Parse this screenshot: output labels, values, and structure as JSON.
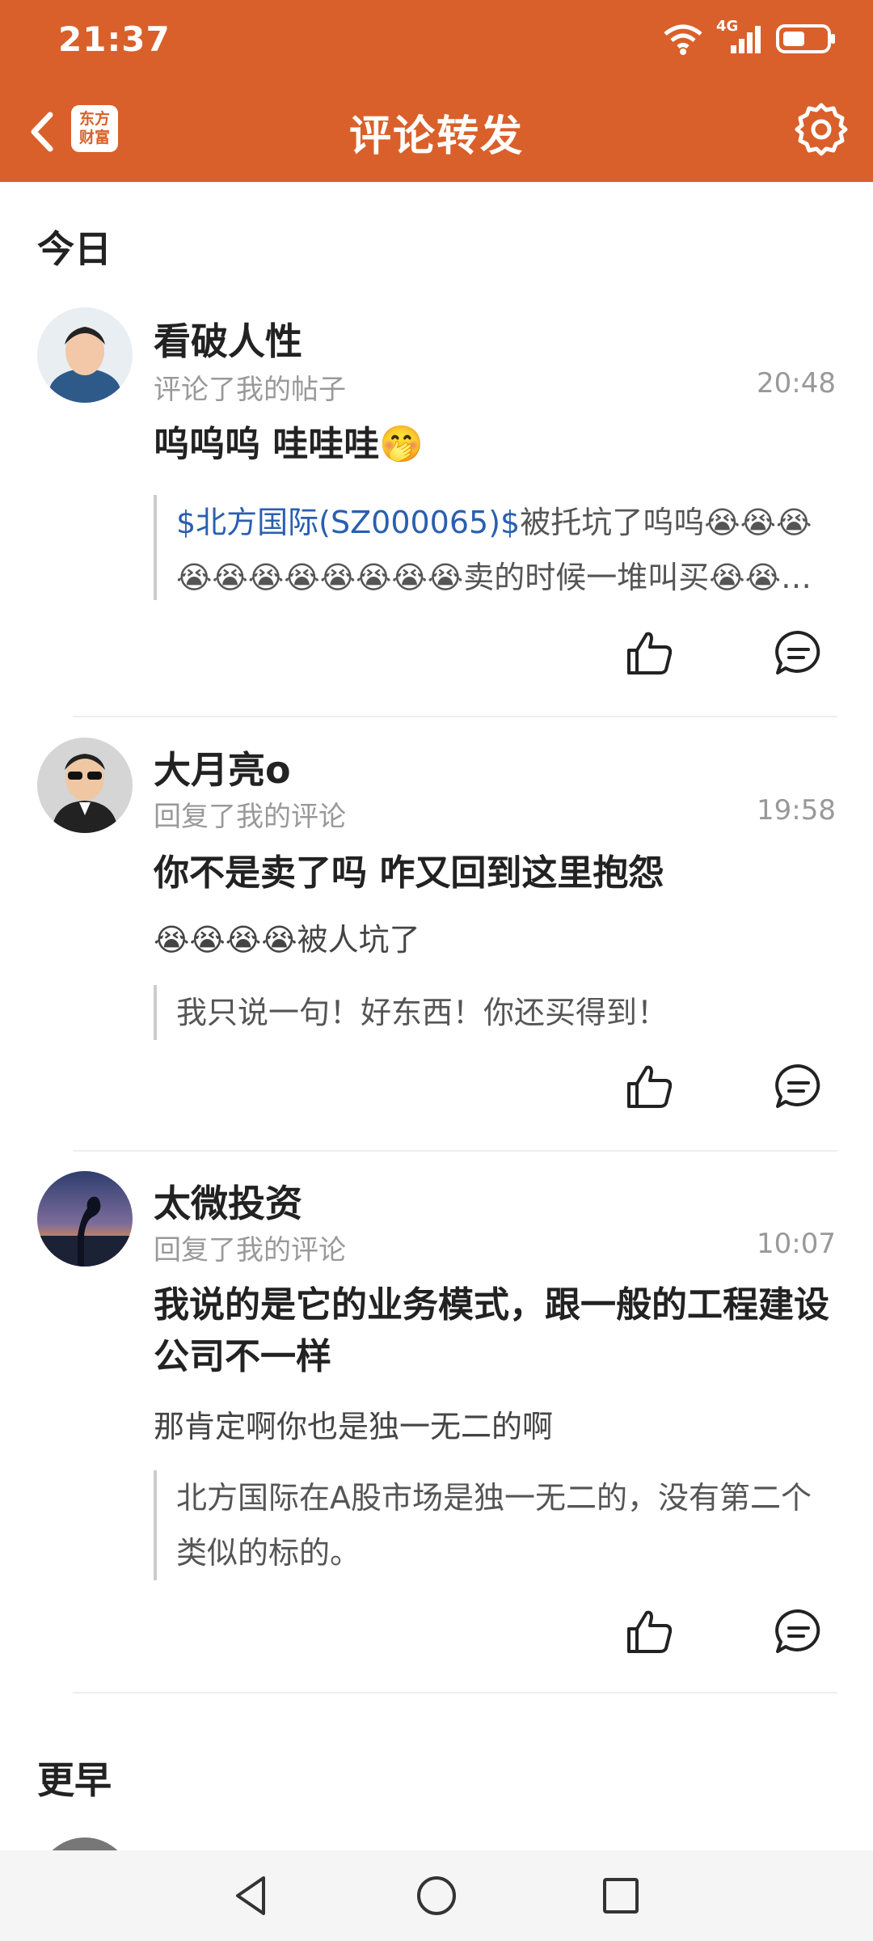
{
  "status": {
    "time": "21:37",
    "network": "4G"
  },
  "header": {
    "title": "评论转发",
    "logo_line1": "东方",
    "logo_line2": "财富"
  },
  "sections": {
    "today": "今日",
    "earlier": "更早"
  },
  "items": [
    {
      "name": "看破人性",
      "action": "评论了我的帖子",
      "time": "20:48",
      "content": "呜呜呜 哇哇哇🤭",
      "quote_link": "$北方国际(SZ000065)$",
      "quote_text1": "被托坑了呜呜😭😭😭",
      "quote_line2": "😭😭😭😭😭😭😭😭卖的时候一堆叫买😭😭…"
    },
    {
      "name": "大月亮o",
      "action": "回复了我的评论",
      "time": "19:58",
      "content": "你不是卖了吗 咋又回到这里抱怨",
      "reply": "😭😭😭😭被人坑了",
      "quote": "我只说一句！好东西！你还买得到！"
    },
    {
      "name": "太微投资",
      "action": "回复了我的评论",
      "time": "10:07",
      "content": "我说的是它的业务模式，跟一般的工程建设公司不一样",
      "reply": "那肯定啊你也是独一无二的啊",
      "quote": "北方国际在A股市场是独一无二的，没有第二个类似的标的。"
    }
  ],
  "colors": {
    "brand": "#D9602A",
    "link": "#2A5FB0"
  }
}
